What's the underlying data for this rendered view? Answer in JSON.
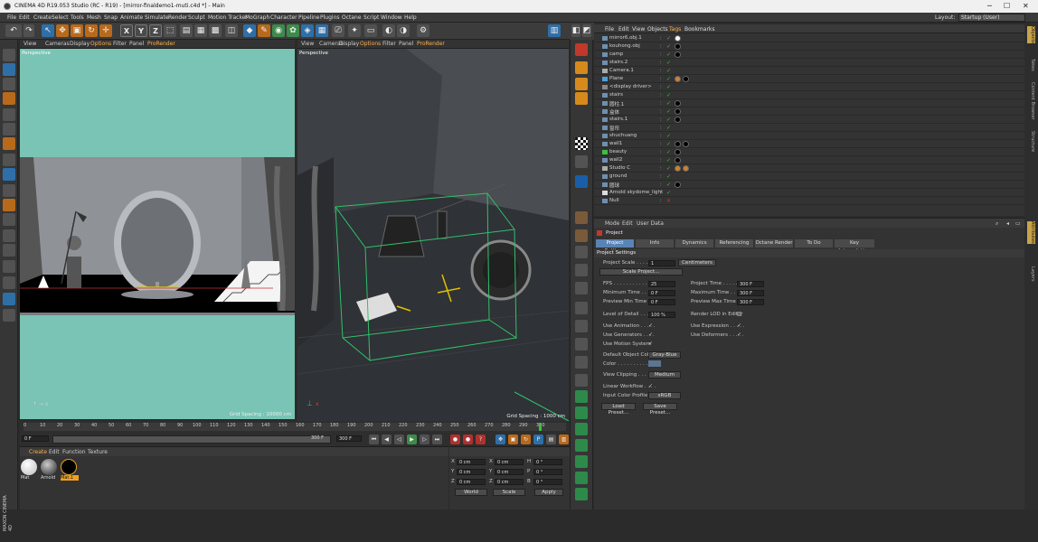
{
  "titlebar": {
    "title": "CINEMA 4D R19.053 Studio (RC - R19) - [mirror-finaldemo1-muti.c4d *] - Main",
    "min": "─",
    "max": "☐",
    "close": "✕"
  },
  "menu": [
    "File",
    "Edit",
    "Create",
    "Select",
    "Tools",
    "Mesh",
    "Snap",
    "Animate",
    "Simulate",
    "Render",
    "Sculpt",
    "Motion Tracker",
    "MoGraph",
    "Character",
    "Pipeline",
    "Plugins",
    "Octane",
    "Script",
    "Window",
    "Help"
  ],
  "layout": {
    "label": "Layout:",
    "value": "Startup (User)"
  },
  "toolbar": {
    "x": "X",
    "y": "Y",
    "z": "Z"
  },
  "vp1": {
    "menu": [
      "View",
      "Cameras",
      "Display",
      "Options",
      "Filter",
      "Panel",
      "ProRender"
    ],
    "label": "Perspective",
    "grid": "Grid Spacing : 10000 cm"
  },
  "vp2": {
    "menu": [
      "View",
      "Cameras",
      "Display",
      "Options",
      "Filter",
      "Panel",
      "ProRender"
    ],
    "label": "Perspective",
    "grid": "Grid Spacing : 1000 cm"
  },
  "timeline": {
    "ticks": [
      "0",
      "10",
      "20",
      "30",
      "40",
      "50",
      "60",
      "70",
      "80",
      "90",
      "100",
      "110",
      "120",
      "130",
      "140",
      "150",
      "160",
      "170",
      "180",
      "190",
      "200",
      "210",
      "220",
      "230",
      "240",
      "250",
      "260",
      "270",
      "280",
      "290",
      "300"
    ],
    "start": "0 F",
    "end_field": "300 F",
    "end_field2": "300 F",
    "current": "0 F",
    "frame_display": "300 F"
  },
  "materials": {
    "menu": [
      "Create",
      "Edit",
      "Function",
      "Texture"
    ],
    "items": [
      {
        "name": "Mat"
      },
      {
        "name": "Arnold"
      },
      {
        "name": "Mat.1"
      }
    ]
  },
  "coords": {
    "rows": [
      {
        "a": "X",
        "v1": "0 cm",
        "b": "X",
        "v2": "0 cm",
        "c": "H",
        "v3": "0 °"
      },
      {
        "a": "Y",
        "v1": "0 cm",
        "b": "Y",
        "v2": "0 cm",
        "c": "P",
        "v3": "0 °"
      },
      {
        "a": "Z",
        "v1": "0 cm",
        "b": "Z",
        "v2": "0 cm",
        "c": "B",
        "v3": "0 °"
      }
    ],
    "mode1": "World",
    "mode2": "Scale",
    "apply": "Apply"
  },
  "objmgr": {
    "menu": [
      "File",
      "Edit",
      "View",
      "Objects",
      "Tags",
      "Bookmarks"
    ],
    "objects": [
      "mirror6.obj.1",
      "kouhong.obj",
      "camp",
      "stairs.2",
      "Camera.1",
      "Plane",
      "<display driver>",
      "stairs",
      "圆柱.1",
      "盒体",
      "stairs.1",
      "窗帘",
      "shuchuang",
      "wall1",
      "beauty",
      "wall2",
      "Studio C",
      "ground",
      "圆球",
      "Arnold skydome_light",
      "Null"
    ]
  },
  "attr": {
    "menu": [
      "Mode",
      "Edit",
      "User Data"
    ],
    "title": "Project",
    "tabs": [
      "Project Settings",
      "Info",
      "Dynamics",
      "Referencing",
      "Octane Render",
      "To Do",
      "Key Interpolation"
    ],
    "section": "Project Settings",
    "project_scale_label": "Project Scale . . . . .",
    "project_scale_value": "1",
    "project_scale_unit": "Centimeters",
    "scale_project": "Scale Project...",
    "fps_label": "FPS . . . . . . . . . . .",
    "fps": "25",
    "proj_time_label": "Project Time . . . . . .",
    "proj_time": "300 F",
    "min_time_label": "Minimum Time . . . .",
    "min_time": "0 F",
    "max_time_label": "Maximum Time . . . .",
    "max_time": "300 F",
    "prev_min_label": "Preview Min Time . .",
    "prev_min": "0 F",
    "prev_max_label": "Preview Max Time . .",
    "prev_max": "300 F",
    "lod_label": "Level of Detail . . . .",
    "lod": "100 %",
    "render_lod": "Render LOD in Editor",
    "use_anim": "Use Animation . . . . .",
    "use_expr": "Use Expression . . . . .",
    "use_gen": "Use Generators . . . .",
    "use_deform": "Use Deformers . . . . .",
    "use_motion": "Use Motion System",
    "def_color_label": "Default Object Color",
    "def_color": "Gray-Blue",
    "color_label": "Color . . . . . . . . . . .",
    "view_clip_label": "View Clipping . . . . .",
    "view_clip": "Medium",
    "linear_label": "Linear Workflow . . . .",
    "input_profile_label": "Input Color Profile",
    "input_profile": "sRGB",
    "load_preset": "Load Preset...",
    "save_preset": "Save Preset..."
  },
  "side_tabs": [
    "Objects",
    "Takes",
    "Content Browser",
    "Structure",
    "Attributes",
    "Layers"
  ],
  "maxon": "MAXON CINEMA 4D"
}
